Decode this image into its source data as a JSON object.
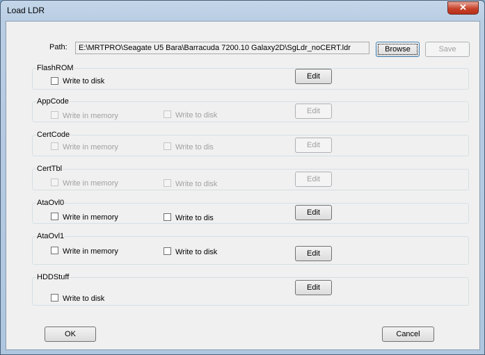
{
  "window": {
    "title": "Load LDR",
    "close_glyph": "✕"
  },
  "path": {
    "label": "Path:",
    "value": "E:\\MRTPRO\\Seagate U5 Bara\\Barracuda 7200.10 Galaxy2D\\SgLdr_noCERT.ldr",
    "browse_label": "Browse",
    "save_label": "Save"
  },
  "groups": [
    {
      "name": "FlashROM",
      "memory_label": "",
      "disk_label": "Write to disk",
      "edit_label": "Edit"
    },
    {
      "name": "AppCode",
      "memory_label": "Write in memory",
      "disk_label": "Write to disk",
      "edit_label": "Edit"
    },
    {
      "name": "CertCode",
      "memory_label": "Write in memory",
      "disk_label": "Write to dis",
      "edit_label": "Edit"
    },
    {
      "name": "CertTbl",
      "memory_label": "Write in memory",
      "disk_label": "Write to disk",
      "edit_label": "Edit"
    },
    {
      "name": "AtaOvl0",
      "memory_label": "Write in memory",
      "disk_label": "Write to dis",
      "edit_label": "Edit"
    },
    {
      "name": "AtaOvl1",
      "memory_label": "Write in memory",
      "disk_label": "Write to disk",
      "edit_label": "Edit"
    },
    {
      "name": "HDDStuff",
      "memory_label": "",
      "disk_label": "Write to disk",
      "edit_label": "Edit"
    }
  ],
  "footer": {
    "ok_label": "OK",
    "cancel_label": "Cancel"
  },
  "colors": {
    "disabled_text": "#a0a0a0",
    "close_button": "#c7432b"
  }
}
